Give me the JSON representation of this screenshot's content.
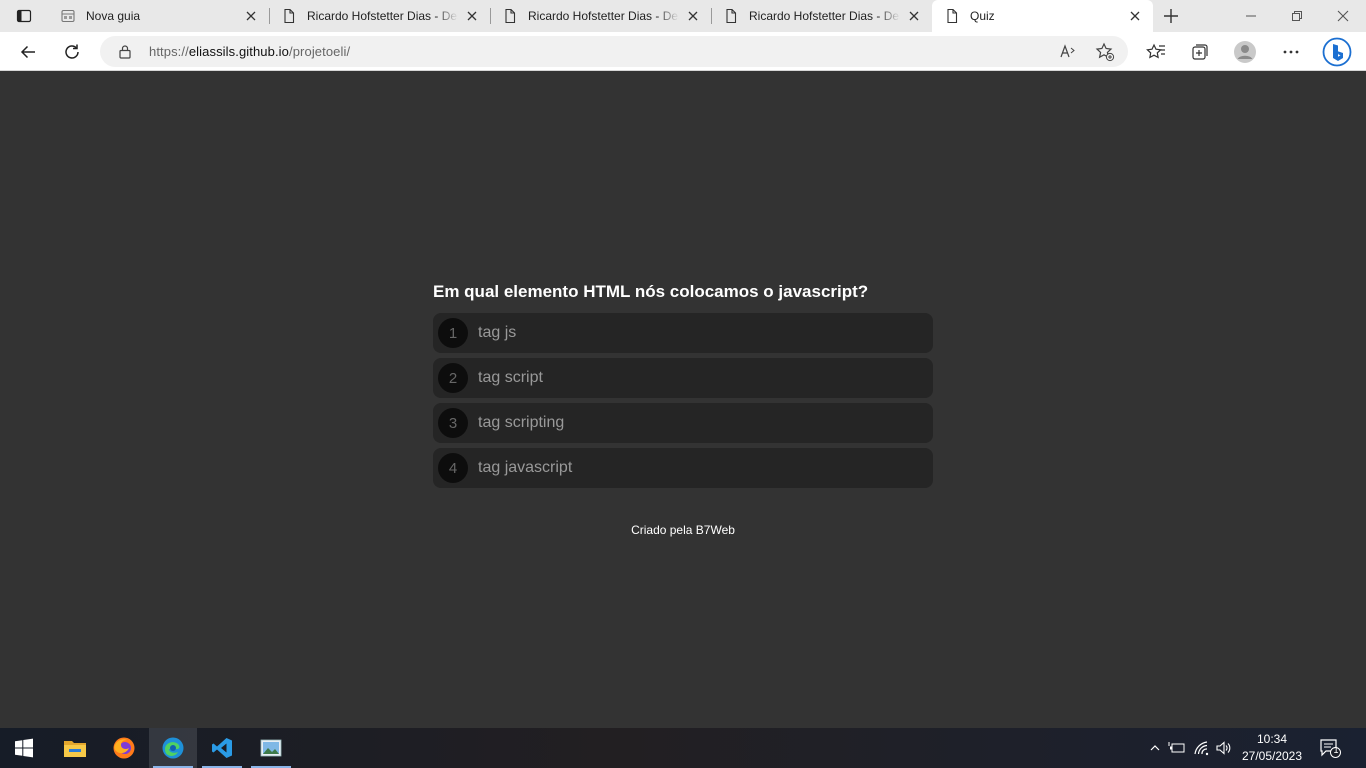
{
  "browser": {
    "tabs": [
      {
        "title": "Nova guia"
      },
      {
        "title": "Ricardo Hofstetter Dias - Desenvolvedor"
      },
      {
        "title": "Ricardo Hofstetter Dias - Desenvolvedor"
      },
      {
        "title": "Ricardo Hofstetter Dias - Desenvolvedor"
      },
      {
        "title": "Quiz"
      }
    ],
    "url_prefix": "https://",
    "url_host": "eliassils.github.io",
    "url_path": "/projetoeli/"
  },
  "quiz": {
    "question": "Em qual elemento HTML nós colocamos o javascript?",
    "options": [
      {
        "num": "1",
        "text": "tag js"
      },
      {
        "num": "2",
        "text": "tag script"
      },
      {
        "num": "3",
        "text": "tag scripting"
      },
      {
        "num": "4",
        "text": "tag javascript"
      }
    ],
    "footer": "Criado pela B7Web"
  },
  "taskbar": {
    "apps": [
      "windows-start",
      "file-explorer",
      "firefox",
      "edge",
      "vscode",
      "photos"
    ],
    "time": "10:34",
    "date": "27/05/2023",
    "notifications": "1"
  }
}
